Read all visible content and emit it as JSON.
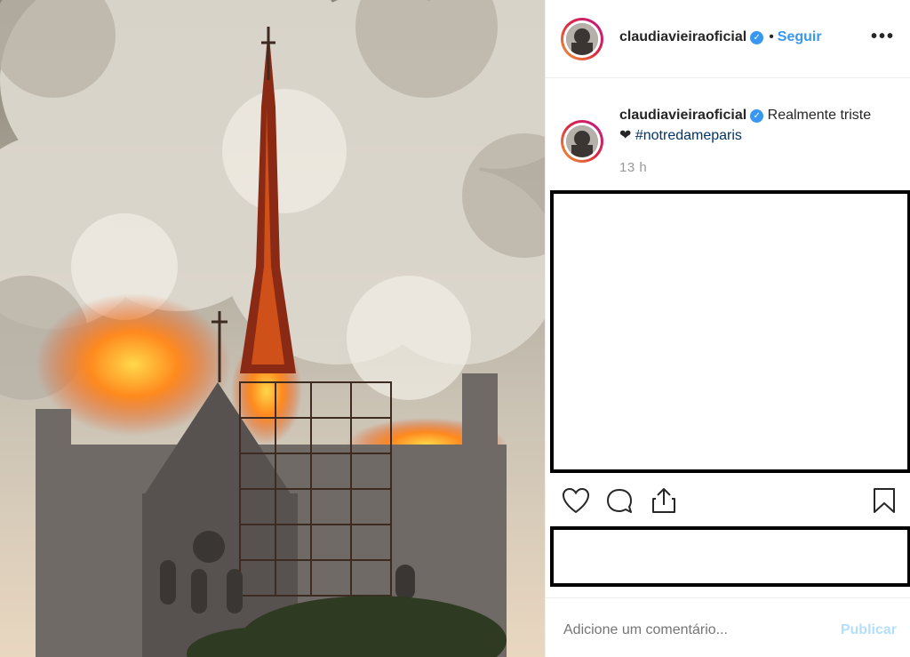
{
  "post": {
    "username": "claudiavieira oficial",
    "username_display": "claudiavieiraoficial",
    "follow_label": "Seguir",
    "separator": "•",
    "more_label": "•••",
    "verified_badge": "✓",
    "caption_text": "Realmente triste",
    "caption_heart": "❤",
    "hashtag": "#notredameparis",
    "time": "13 h"
  },
  "comment": {
    "placeholder": "Adicione um comentário...",
    "publish_label": "Publicar"
  },
  "icons": {
    "like": "heart-icon",
    "comment": "comment-icon",
    "share": "share-icon",
    "save": "bookmark-icon"
  },
  "colors": {
    "link_blue": "#3897f0",
    "hashtag": "#003569",
    "publish_disabled": "#b2dffc"
  }
}
